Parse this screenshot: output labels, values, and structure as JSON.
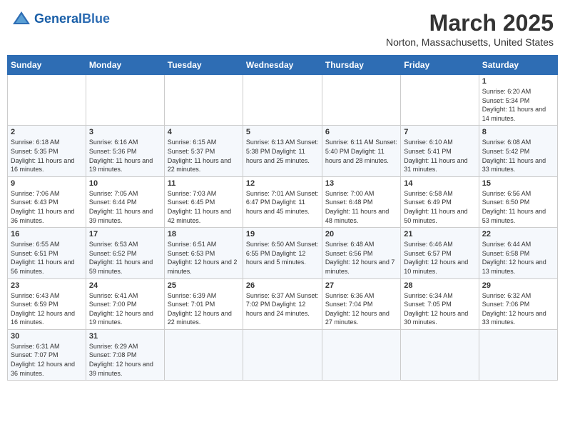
{
  "header": {
    "logo_general": "General",
    "logo_blue": "Blue",
    "month_title": "March 2025",
    "location": "Norton, Massachusetts, United States"
  },
  "weekdays": [
    "Sunday",
    "Monday",
    "Tuesday",
    "Wednesday",
    "Thursday",
    "Friday",
    "Saturday"
  ],
  "weeks": [
    [
      {
        "day": "",
        "info": ""
      },
      {
        "day": "",
        "info": ""
      },
      {
        "day": "",
        "info": ""
      },
      {
        "day": "",
        "info": ""
      },
      {
        "day": "",
        "info": ""
      },
      {
        "day": "",
        "info": ""
      },
      {
        "day": "1",
        "info": "Sunrise: 6:20 AM\nSunset: 5:34 PM\nDaylight: 11 hours\nand 14 minutes."
      }
    ],
    [
      {
        "day": "2",
        "info": "Sunrise: 6:18 AM\nSunset: 5:35 PM\nDaylight: 11 hours\nand 16 minutes."
      },
      {
        "day": "3",
        "info": "Sunrise: 6:16 AM\nSunset: 5:36 PM\nDaylight: 11 hours\nand 19 minutes."
      },
      {
        "day": "4",
        "info": "Sunrise: 6:15 AM\nSunset: 5:37 PM\nDaylight: 11 hours\nand 22 minutes."
      },
      {
        "day": "5",
        "info": "Sunrise: 6:13 AM\nSunset: 5:38 PM\nDaylight: 11 hours\nand 25 minutes."
      },
      {
        "day": "6",
        "info": "Sunrise: 6:11 AM\nSunset: 5:40 PM\nDaylight: 11 hours\nand 28 minutes."
      },
      {
        "day": "7",
        "info": "Sunrise: 6:10 AM\nSunset: 5:41 PM\nDaylight: 11 hours\nand 31 minutes."
      },
      {
        "day": "8",
        "info": "Sunrise: 6:08 AM\nSunset: 5:42 PM\nDaylight: 11 hours\nand 33 minutes."
      }
    ],
    [
      {
        "day": "9",
        "info": "Sunrise: 7:06 AM\nSunset: 6:43 PM\nDaylight: 11 hours\nand 36 minutes."
      },
      {
        "day": "10",
        "info": "Sunrise: 7:05 AM\nSunset: 6:44 PM\nDaylight: 11 hours\nand 39 minutes."
      },
      {
        "day": "11",
        "info": "Sunrise: 7:03 AM\nSunset: 6:45 PM\nDaylight: 11 hours\nand 42 minutes."
      },
      {
        "day": "12",
        "info": "Sunrise: 7:01 AM\nSunset: 6:47 PM\nDaylight: 11 hours\nand 45 minutes."
      },
      {
        "day": "13",
        "info": "Sunrise: 7:00 AM\nSunset: 6:48 PM\nDaylight: 11 hours\nand 48 minutes."
      },
      {
        "day": "14",
        "info": "Sunrise: 6:58 AM\nSunset: 6:49 PM\nDaylight: 11 hours\nand 50 minutes."
      },
      {
        "day": "15",
        "info": "Sunrise: 6:56 AM\nSunset: 6:50 PM\nDaylight: 11 hours\nand 53 minutes."
      }
    ],
    [
      {
        "day": "16",
        "info": "Sunrise: 6:55 AM\nSunset: 6:51 PM\nDaylight: 11 hours\nand 56 minutes."
      },
      {
        "day": "17",
        "info": "Sunrise: 6:53 AM\nSunset: 6:52 PM\nDaylight: 11 hours\nand 59 minutes."
      },
      {
        "day": "18",
        "info": "Sunrise: 6:51 AM\nSunset: 6:53 PM\nDaylight: 12 hours\nand 2 minutes."
      },
      {
        "day": "19",
        "info": "Sunrise: 6:50 AM\nSunset: 6:55 PM\nDaylight: 12 hours\nand 5 minutes."
      },
      {
        "day": "20",
        "info": "Sunrise: 6:48 AM\nSunset: 6:56 PM\nDaylight: 12 hours\nand 7 minutes."
      },
      {
        "day": "21",
        "info": "Sunrise: 6:46 AM\nSunset: 6:57 PM\nDaylight: 12 hours\nand 10 minutes."
      },
      {
        "day": "22",
        "info": "Sunrise: 6:44 AM\nSunset: 6:58 PM\nDaylight: 12 hours\nand 13 minutes."
      }
    ],
    [
      {
        "day": "23",
        "info": "Sunrise: 6:43 AM\nSunset: 6:59 PM\nDaylight: 12 hours\nand 16 minutes."
      },
      {
        "day": "24",
        "info": "Sunrise: 6:41 AM\nSunset: 7:00 PM\nDaylight: 12 hours\nand 19 minutes."
      },
      {
        "day": "25",
        "info": "Sunrise: 6:39 AM\nSunset: 7:01 PM\nDaylight: 12 hours\nand 22 minutes."
      },
      {
        "day": "26",
        "info": "Sunrise: 6:37 AM\nSunset: 7:02 PM\nDaylight: 12 hours\nand 24 minutes."
      },
      {
        "day": "27",
        "info": "Sunrise: 6:36 AM\nSunset: 7:04 PM\nDaylight: 12 hours\nand 27 minutes."
      },
      {
        "day": "28",
        "info": "Sunrise: 6:34 AM\nSunset: 7:05 PM\nDaylight: 12 hours\nand 30 minutes."
      },
      {
        "day": "29",
        "info": "Sunrise: 6:32 AM\nSunset: 7:06 PM\nDaylight: 12 hours\nand 33 minutes."
      }
    ],
    [
      {
        "day": "30",
        "info": "Sunrise: 6:31 AM\nSunset: 7:07 PM\nDaylight: 12 hours\nand 36 minutes."
      },
      {
        "day": "31",
        "info": "Sunrise: 6:29 AM\nSunset: 7:08 PM\nDaylight: 12 hours\nand 39 minutes."
      },
      {
        "day": "",
        "info": ""
      },
      {
        "day": "",
        "info": ""
      },
      {
        "day": "",
        "info": ""
      },
      {
        "day": "",
        "info": ""
      },
      {
        "day": "",
        "info": ""
      }
    ]
  ]
}
